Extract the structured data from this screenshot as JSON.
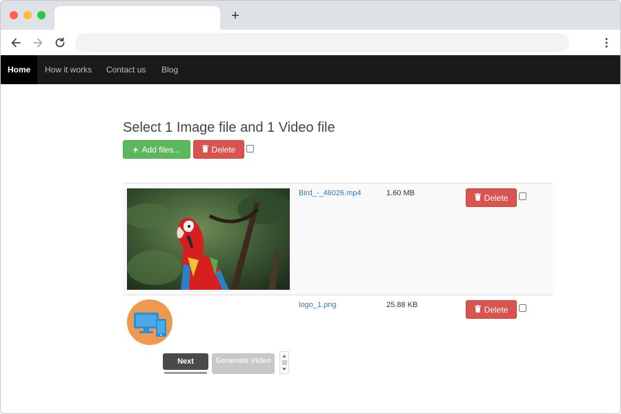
{
  "browser": {
    "new_tab_label": "+",
    "address_value": ""
  },
  "nav": {
    "items": [
      {
        "label": "Home",
        "active": true
      },
      {
        "label": "How it works"
      },
      {
        "label": "Contact us"
      },
      {
        "label": "Blog"
      }
    ]
  },
  "uploader": {
    "title": "Select 1 Image file and 1 Video file",
    "add_files_label": "Add files...",
    "delete_all_label": "Delete",
    "files": [
      {
        "name": "Bird_-_46026.mp4",
        "size": "1.60 MB",
        "delete_label": "Delete",
        "preview": "parrot-image"
      },
      {
        "name": "logo_1.png",
        "size": "25.88 KB",
        "delete_label": "Delete",
        "preview": "devices-logo"
      }
    ]
  },
  "actions": {
    "next_label": "Next",
    "generate_label": "Generate Video"
  },
  "colors": {
    "success": "#5cb85c",
    "danger": "#d9534f",
    "navbar": "#1a1a1a",
    "link": "#337ab7",
    "logo_bg": "#ed9a50",
    "logo_fg": "#2b8fd4"
  }
}
